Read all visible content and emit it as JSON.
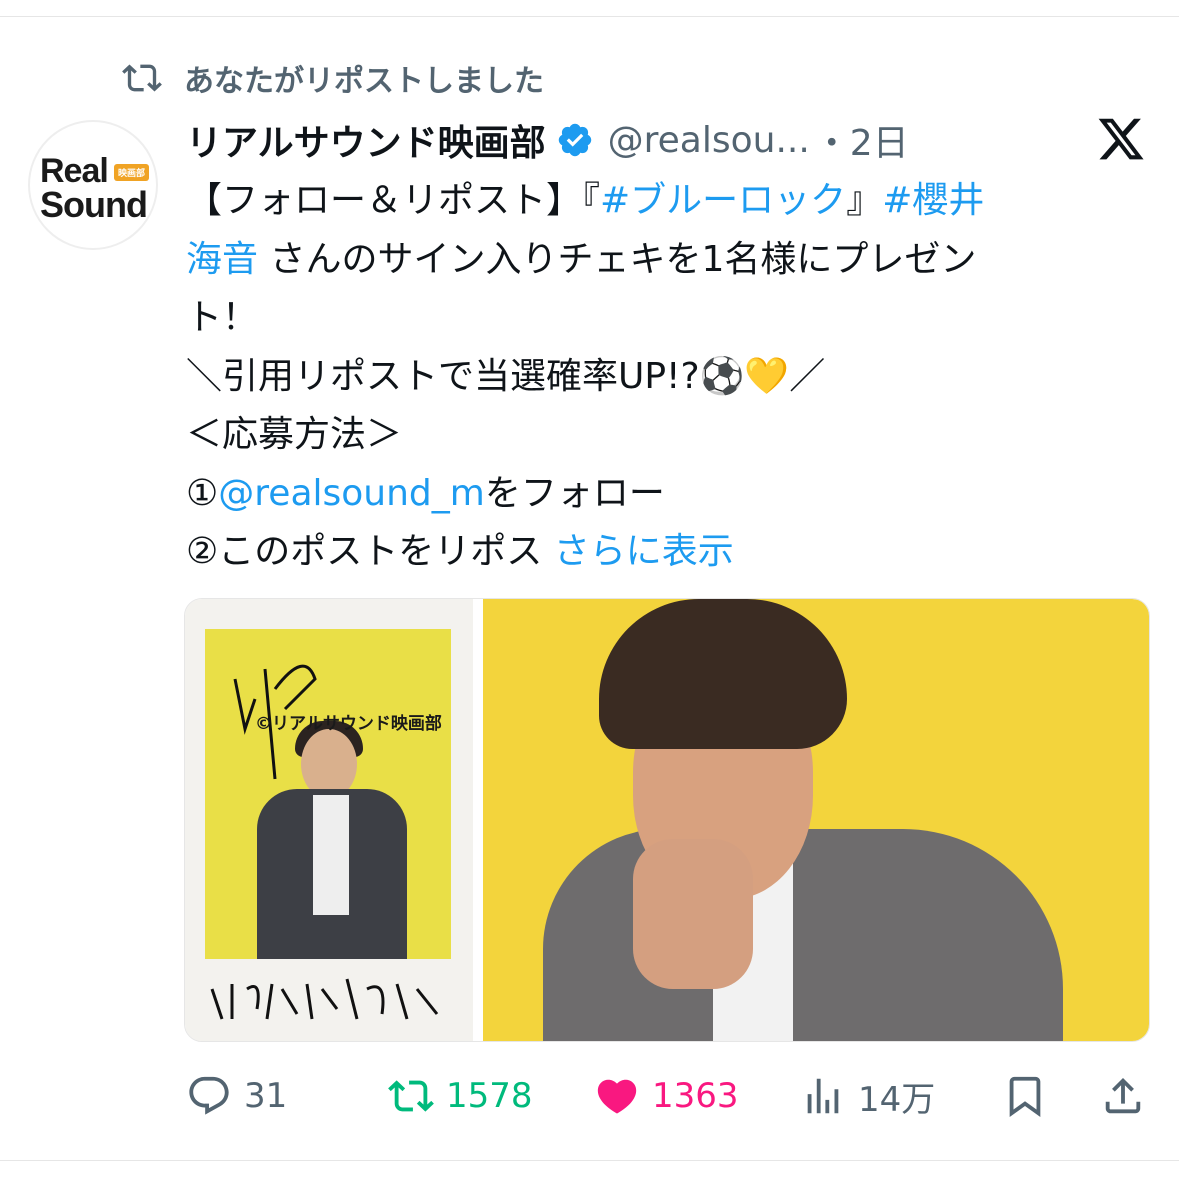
{
  "repost_notice": {
    "text": "あなたがリポストしました",
    "icon": "repost-icon"
  },
  "avatar": {
    "line1": "Real",
    "line2": "Sound",
    "tag": "映画部"
  },
  "post": {
    "author_name": "リアルサウンド映画部",
    "handle": "@realsou...",
    "time": "・2日",
    "platform_icon": "x-logo-icon",
    "lines": {
      "l1a": "【フォロー＆リポスト】『",
      "l1b": "#ブルーロック",
      "l1c": "』",
      "l1d": "#櫻井",
      "l2a": "海音",
      "l2b": " さんのサイン入りチェキを1名様にプレゼン",
      "l3": "ト！",
      "l4": "＼引用リポストで当選確率UP!?⚽💛／",
      "l5": "＜応募方法＞",
      "l6a": "①",
      "l6b": "@realsound_m",
      "l6c": "をフォロー",
      "l7a": "②このポストをリポス ",
      "l7b": "さらに表示"
    }
  },
  "media": {
    "watermark": "©リアルサウンド映画部"
  },
  "actions": {
    "replies": "31",
    "reposts": "1578",
    "likes": "1363",
    "views": "14万"
  },
  "colors": {
    "link": "#1d9bf0",
    "muted": "#536471",
    "repost_green": "#00ba7c",
    "like_pink": "#f91880",
    "verified_blue": "#1d9bf0"
  }
}
